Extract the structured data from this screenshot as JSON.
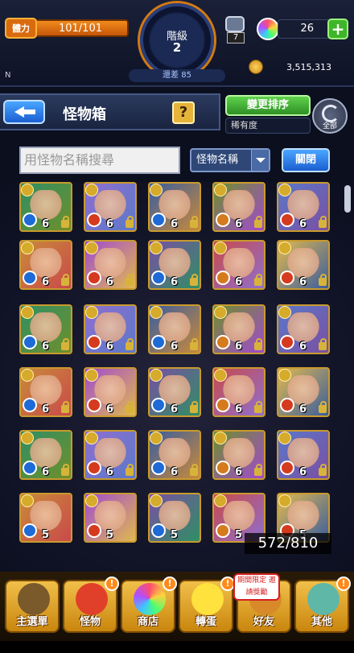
{
  "hud": {
    "stamina_label": "體力",
    "stamina_value": "101/101",
    "level_label": "階級",
    "level_value": "2",
    "gap_label": "還差 85",
    "watch_count": "7",
    "orb_count": "26",
    "plus_label": "+",
    "gold": "3,515,313",
    "rank_flag": "N"
  },
  "header": {
    "title": "怪物箱",
    "help_label": "?",
    "sort_button": "變更排序",
    "sort_current": "稀有度",
    "refresh_label": "全部"
  },
  "search": {
    "placeholder": "用怪物名稱搜尋",
    "filter_value": "怪物名稱",
    "close_button": "關閉"
  },
  "grid": {
    "count": "572/810",
    "levels": [
      "6",
      "6",
      "6",
      "6",
      "6",
      "6",
      "6",
      "6",
      "6",
      "6",
      "6",
      "6",
      "6",
      "6",
      "6",
      "6",
      "6",
      "6",
      "6",
      "6",
      "6",
      "6",
      "6",
      "6",
      "6",
      "5",
      "5",
      "5",
      "5",
      "5"
    ],
    "element_colors": [
      "#1e6ad6",
      "#d63a1e",
      "#1e6ad6",
      "#d67a1e",
      "#d63a1e"
    ],
    "card_palette": [
      "#2f8f64",
      "#8e6fd0",
      "#3a5d9e",
      "#6f8f2a",
      "#5b78c9",
      "#c98a3a",
      "#a14ad0",
      "#7a4fa3",
      "#c94a4a",
      "#e0b84f"
    ]
  },
  "nav": {
    "items": [
      {
        "label": "主選單",
        "icon": "house-icon"
      },
      {
        "label": "怪物",
        "icon": "monster-icon"
      },
      {
        "label": "商店",
        "icon": "shop-orb-icon"
      },
      {
        "label": "轉蛋",
        "icon": "gacha-egg-icon"
      },
      {
        "label": "好友",
        "icon": "friend-icon"
      },
      {
        "label": "其他",
        "icon": "other-icon"
      }
    ],
    "event_tag": "期間限定\n邀請獎勵",
    "alert": "!"
  }
}
